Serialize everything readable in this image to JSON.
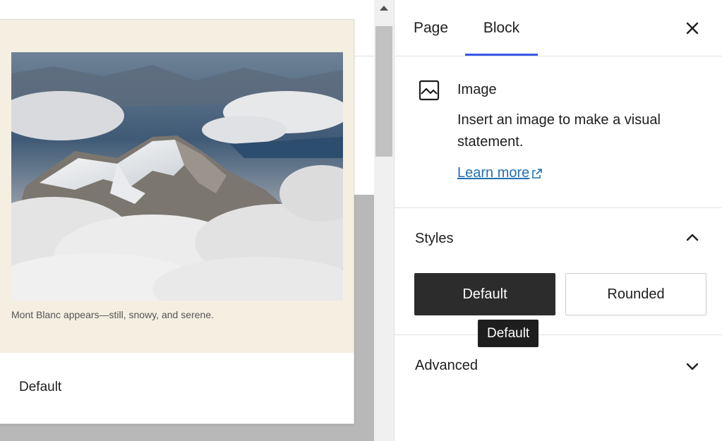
{
  "preview": {
    "caption": "Mont Blanc appears—still, snowy, and serene.",
    "style_label": "Default"
  },
  "sidebar": {
    "tabs": [
      {
        "label": "Page",
        "active": false
      },
      {
        "label": "Block",
        "active": true
      }
    ],
    "close_icon": "close-icon",
    "block": {
      "icon": "image-icon",
      "title": "Image",
      "description": "Insert an image to make a visual statement.",
      "learn_more": "Learn more"
    },
    "styles": {
      "title": "Styles",
      "expanded": true,
      "options": [
        {
          "label": "Default",
          "selected": true
        },
        {
          "label": "Rounded",
          "selected": false
        }
      ],
      "tooltip": "Default"
    },
    "advanced": {
      "title": "Advanced",
      "expanded": false
    }
  },
  "colors": {
    "accent": "#3858e9",
    "link": "#2271b1",
    "selected_style_bg": "#2c2c2c",
    "preview_bg": "#f5efe1"
  }
}
